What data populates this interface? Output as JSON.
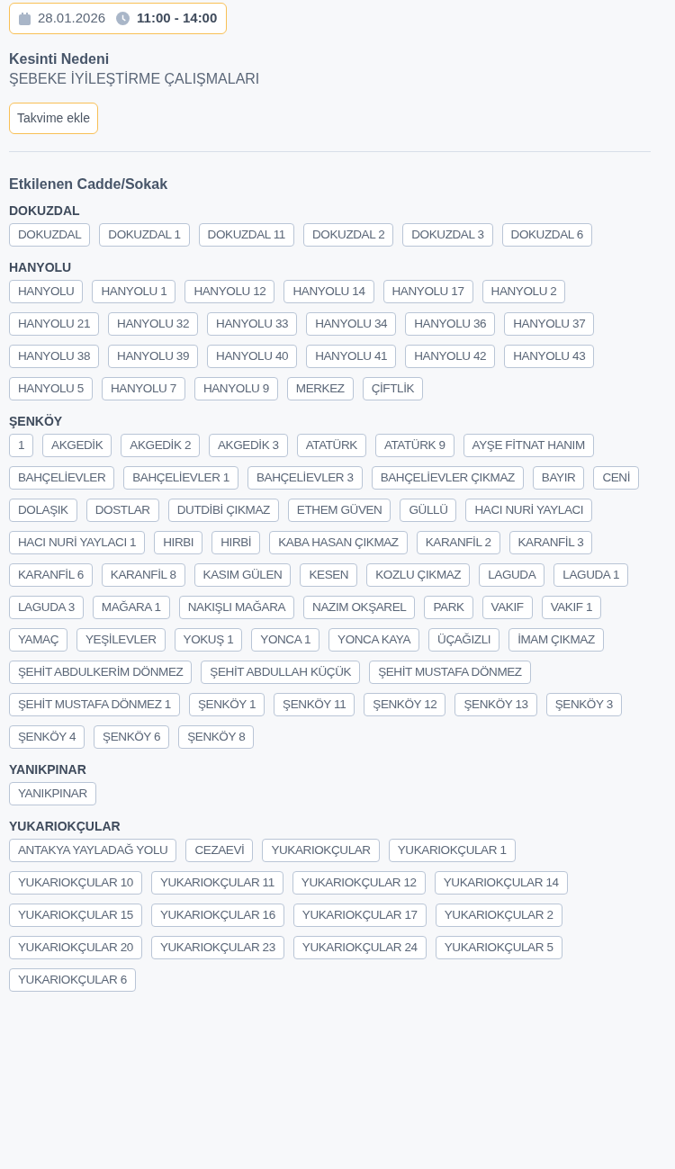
{
  "schedule": {
    "date": "28.01.2026",
    "time": "11:00 - 14:00"
  },
  "reason": {
    "label": "Kesinti Nedeni",
    "value": "ŞEBEKE İYİLEŞTİRME ÇALIŞMALARI"
  },
  "calendar_button": "Takvime ekle",
  "affected": {
    "title": "Etkilenen Cadde/Sokak",
    "groups": [
      {
        "name": "DOKUZDAL",
        "streets": [
          "DOKUZDAL",
          "DOKUZDAL 1",
          "DOKUZDAL 11",
          "DOKUZDAL 2",
          "DOKUZDAL 3",
          "DOKUZDAL 6"
        ]
      },
      {
        "name": "HANYOLU",
        "streets": [
          "HANYOLU",
          "HANYOLU 1",
          "HANYOLU 12",
          "HANYOLU 14",
          "HANYOLU 17",
          "HANYOLU 2",
          "HANYOLU 21",
          "HANYOLU 32",
          "HANYOLU 33",
          "HANYOLU 34",
          "HANYOLU 36",
          "HANYOLU 37",
          "HANYOLU 38",
          "HANYOLU 39",
          "HANYOLU 40",
          "HANYOLU 41",
          "HANYOLU 42",
          "HANYOLU 43",
          "HANYOLU 5",
          "HANYOLU 7",
          "HANYOLU 9",
          "MERKEZ",
          "ÇİFTLİK"
        ]
      },
      {
        "name": "ŞENKÖY",
        "streets": [
          "1",
          "AKGEDİK",
          "AKGEDİK 2",
          "AKGEDİK 3",
          "ATATÜRK",
          "ATATÜRK 9",
          "AYŞE FİTNAT HANIM",
          "BAHÇELİEVLER",
          "BAHÇELİEVLER 1",
          "BAHÇELİEVLER 3",
          "BAHÇELİEVLER ÇIKMAZ",
          "BAYIR",
          "CENİ",
          "DOLAŞIK",
          "DOSTLAR",
          "DUTDİBİ ÇIKMAZ",
          "ETHEM GÜVEN",
          "GÜLLÜ",
          "HACI NURİ YAYLACI",
          "HACI NURİ YAYLACI 1",
          "HIRBI",
          "HIRBİ",
          "KABA HASAN ÇIKMAZ",
          "KARANFİL 2",
          "KARANFİL 3",
          "KARANFİL 6",
          "KARANFİL 8",
          "KASIM GÜLEN",
          "KESEN",
          "KOZLU ÇIKMAZ",
          "LAGUDA",
          "LAGUDA 1",
          "LAGUDA 3",
          "MAĞARA 1",
          "NAKIŞLI MAĞARA",
          "NAZIM OKŞAREL",
          "PARK",
          "VAKIF",
          "VAKIF 1",
          "YAMAÇ",
          "YEŞİLEVLER",
          "YOKUŞ 1",
          "YONCA 1",
          "YONCA KAYA",
          "ÜÇAĞIZLI",
          "İMAM ÇIKMAZ",
          "ŞEHİT ABDULKERİM DÖNMEZ",
          "ŞEHİT ABDULLAH KÜÇÜK",
          "ŞEHİT MUSTAFA DÖNMEZ",
          "ŞEHİT MUSTAFA DÖNMEZ 1",
          "ŞENKÖY 1",
          "ŞENKÖY 11",
          "ŞENKÖY 12",
          "ŞENKÖY 13",
          "ŞENKÖY 3",
          "ŞENKÖY 4",
          "ŞENKÖY 6",
          "ŞENKÖY 8"
        ]
      },
      {
        "name": "YANIKPINAR",
        "streets": [
          "YANIKPINAR"
        ]
      },
      {
        "name": "YUKARIOKÇULAR",
        "streets": [
          "ANTAKYA YAYLADAĞ YOLU",
          "CEZAEVİ",
          "YUKARIOKÇULAR",
          "YUKARIOKÇULAR 1",
          "YUKARIOKÇULAR 10",
          "YUKARIOKÇULAR 11",
          "YUKARIOKÇULAR 12",
          "YUKARIOKÇULAR 14",
          "YUKARIOKÇULAR 15",
          "YUKARIOKÇULAR 16",
          "YUKARIOKÇULAR 17",
          "YUKARIOKÇULAR 2",
          "YUKARIOKÇULAR 20",
          "YUKARIOKÇULAR 23",
          "YUKARIOKÇULAR 24",
          "YUKARIOKÇULAR 5",
          "YUKARIOKÇULAR 6"
        ]
      }
    ]
  }
}
